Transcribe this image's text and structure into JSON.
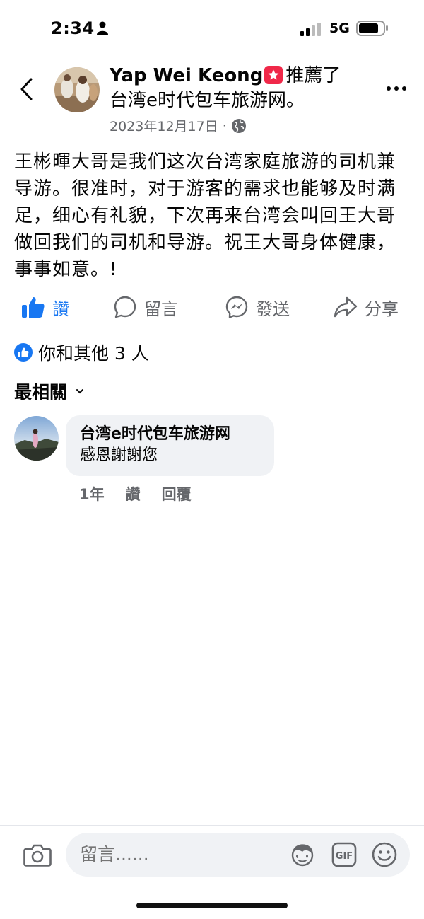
{
  "status_bar": {
    "time": "2:34",
    "network": "5G",
    "icons": [
      "person-icon",
      "signal-icon",
      "battery-icon"
    ]
  },
  "post": {
    "author": "Yap Wei Keong",
    "action_text": "推薦了",
    "page_name": "台湾e时代包车旅游网。",
    "date": "2023年12月17日",
    "separator": "·",
    "body": "王彬暉大哥是我们这次台湾家庭旅游的司机兼导游。很准时，对于游客的需求也能够及时满足，细心有礼貌，下次再来台湾会叫回王大哥做回我们的司机和导游。祝王大哥身体健康，事事如意。!"
  },
  "actions": {
    "like": "讚",
    "comment": "留言",
    "send": "發送",
    "share": "分享"
  },
  "reactions": {
    "summary": "你和其他 3 人"
  },
  "comments": {
    "sort_label": "最相關",
    "items": [
      {
        "author": "台湾e时代包车旅游网",
        "text": "感恩謝謝您",
        "time": "1年",
        "like": "讚",
        "reply": "回覆"
      }
    ]
  },
  "composer": {
    "placeholder": "留言......"
  },
  "colors": {
    "accent": "#1877f2",
    "secondary_text": "#65676b",
    "bubble_bg": "#f0f2f5",
    "recommend_badge": "#f02849"
  }
}
